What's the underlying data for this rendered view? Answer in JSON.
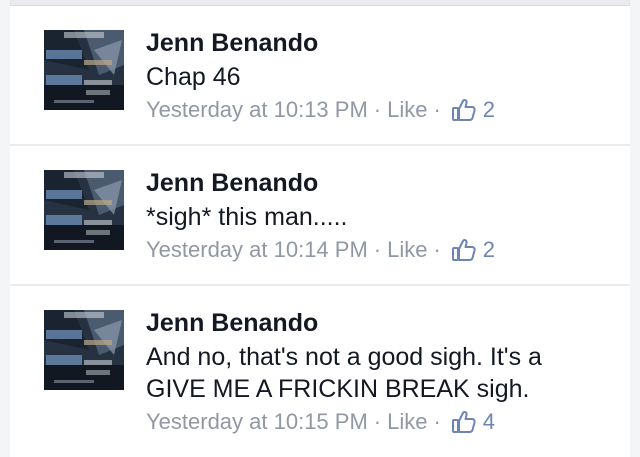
{
  "comments": [
    {
      "author": "Jenn Benando",
      "text": "Chap 46",
      "timestamp": "Yesterday at 10:13 PM",
      "like_label": "Like",
      "like_count": "2",
      "avatar_icon": "book-cover-avatar"
    },
    {
      "author": "Jenn Benando",
      "text": "*sigh* this man.....",
      "timestamp": "Yesterday at 10:14 PM",
      "like_label": "Like",
      "like_count": "2",
      "avatar_icon": "book-cover-avatar"
    },
    {
      "author": "Jenn Benando",
      "text": "And no, that's not a good sigh. It's a GIVE ME A FRICKIN BREAK sigh.",
      "timestamp": "Yesterday at 10:15 PM",
      "like_label": "Like",
      "like_count": "4",
      "avatar_icon": "book-cover-avatar"
    }
  ],
  "separator": "·",
  "colors": {
    "like_blue": "#6d84b4",
    "meta_gray": "#9197a3",
    "name_black": "#141823"
  },
  "icons": {
    "like": "thumbs-up-icon"
  }
}
